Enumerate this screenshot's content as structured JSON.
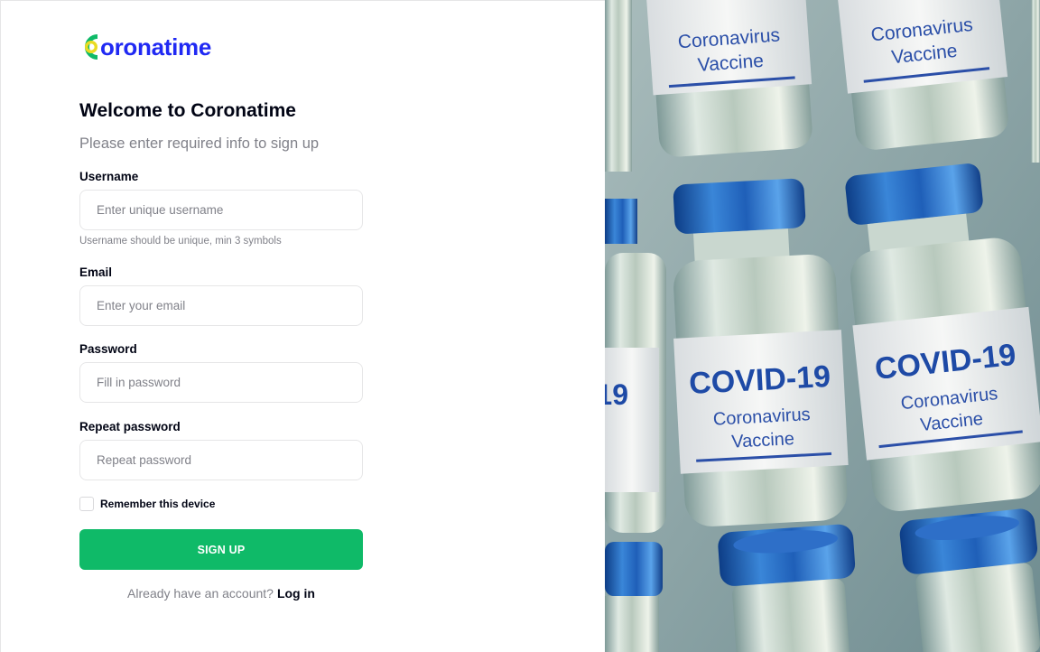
{
  "brand": {
    "logo_text": "oronatime",
    "logo_full": "Coronatime"
  },
  "header": {
    "title": "Welcome to Coronatime",
    "subtitle": "Please enter required info to sign up"
  },
  "form": {
    "username": {
      "label": "Username",
      "placeholder": "Enter unique username",
      "value": "",
      "hint": "Username should be unique, min 3 symbols"
    },
    "email": {
      "label": "Email",
      "placeholder": "Enter your email",
      "value": ""
    },
    "password": {
      "label": "Password",
      "placeholder": "Fill in password",
      "value": ""
    },
    "repeat_password": {
      "label": "Repeat password",
      "placeholder": "Repeat password",
      "value": ""
    },
    "remember": {
      "label": "Remember this device",
      "checked": false
    },
    "submit_label": "SIGN UP"
  },
  "footer": {
    "prompt": "Already have an account?",
    "login_label": "Log in"
  },
  "illustration": {
    "subject": "covid-19-vaccine-vials-photo",
    "vial_text": {
      "title": "COVID-19",
      "line1": "Coronavirus",
      "line2": "Vaccine"
    }
  },
  "colors": {
    "accent": "#0fba68",
    "brand_blue": "#2029f3",
    "logo_yellow": "#eaD621",
    "text_dark": "#010414",
    "text_muted": "#808189"
  }
}
